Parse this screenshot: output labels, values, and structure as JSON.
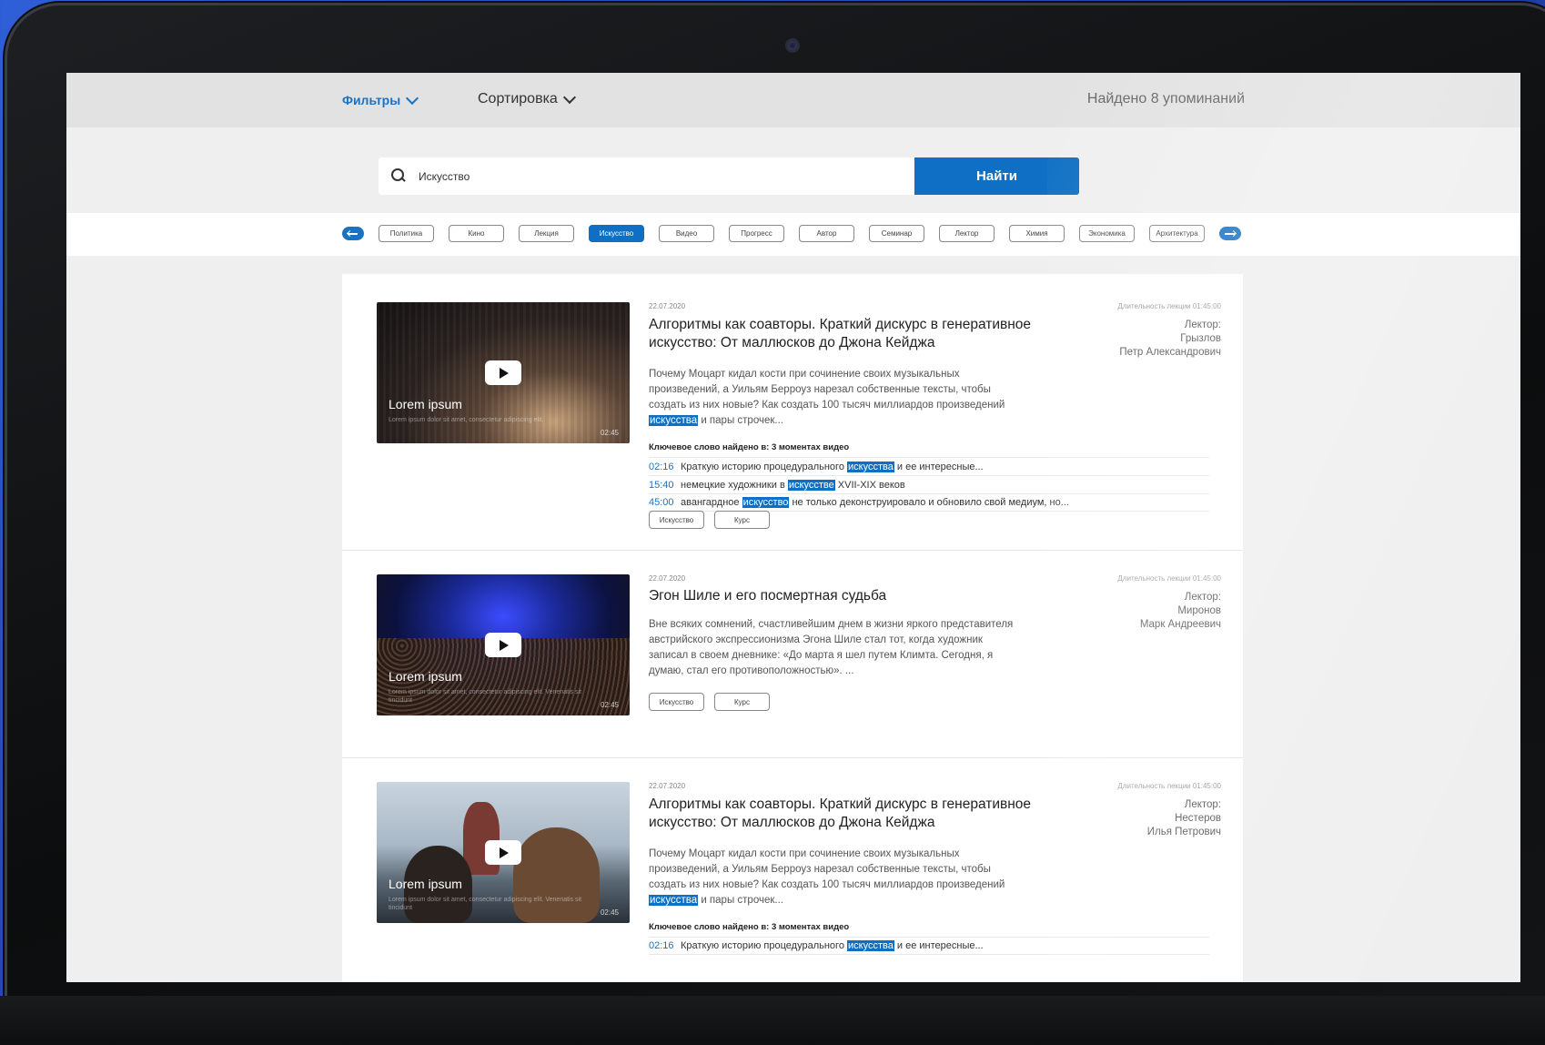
{
  "topbar": {
    "filters_label": "Фильтры",
    "sort_label": "Сортировка",
    "found_text": "Найдено 8 упоминаний"
  },
  "search": {
    "value": "Искусство",
    "button_label": "Найти"
  },
  "tags": [
    "Политика",
    "Кино",
    "Лекция",
    "Искусство",
    "Видео",
    "Прогресс",
    "Автор",
    "Семинар",
    "Лектор",
    "Химия",
    "Экономика",
    "Архитектура"
  ],
  "active_tag": "Искусство",
  "accent_color": "#0e6fc4",
  "results": [
    {
      "thumb_title": "Lorem ipsum",
      "thumb_sub": "Lorem ipsum dolor sit amet, consectetur adipiscing elit.",
      "thumb_duration": "02:45",
      "date": "22.07.2020",
      "title": "Алгоритмы как соавторы. Краткий дискурс в генеративное искусство: От маллюсков до Джона Кейджа",
      "duration_text": "Длительность лекции 01:45:00",
      "lector_label": "Лектор:",
      "lector_last": "Грызлов",
      "lector_first": "Петр Александрович",
      "desc_before": "Почему Моцарт кидал кости при сочинение своих музыкальных произведений, а Уильям Берроуз нарезал собственные тексты, чтобы создать из них новые?  Как создать 100 тысяч миллиардов произведений",
      "desc_hl": "искусства",
      "desc_after": "и пары строчек...",
      "kw_found": "Ключевое слово найдено в:  3 моментах видео",
      "moments": [
        {
          "time": "02:16",
          "before": "Краткую историю процедурального",
          "hl": "искусства",
          "after": "и ее интересные..."
        },
        {
          "time": "15:40",
          "before": "немецкие художники в",
          "hl": "искусстве",
          "after": "XVII-XIX веков"
        },
        {
          "time": "45:00",
          "before": "авангардное",
          "hl": "искусство",
          "after": "не только деконструировало и обновило свой медиум, но..."
        }
      ],
      "tags": [
        "Искусство",
        "Курс"
      ]
    },
    {
      "thumb_title": "Lorem ipsum",
      "thumb_sub": "Lorem ipsum dolor sit amet, consectetur adipiscing elit. Venenatis sit tincidunt",
      "thumb_duration": "02:45",
      "date": "22.07.2020",
      "title": "Эгон Шиле и его посмертная судьба",
      "duration_text": "Длительность лекции 01:45:00",
      "lector_label": "Лектор:",
      "lector_last": "Миронов",
      "lector_first": "Марк Андреевич",
      "desc_before": "Вне всяких сомнений, счастливейшим днем в жизни яркого представителя австрийского экспрессионизма Эгона Шиле стал тот, когда художник записал в своем дневнике: «До марта я шел путем Климта. Сегодня, я думаю, стал его противоположностью». ...",
      "desc_hl": "",
      "desc_after": "",
      "tags": [
        "Искусство",
        "Курс"
      ]
    },
    {
      "thumb_title": "Lorem ipsum",
      "thumb_sub": "Lorem ipsum dolor sit amet, consectetur adipiscing elit. Venenatis sit tincidunt",
      "thumb_duration": "02:45",
      "date": "22.07.2020",
      "title": "Алгоритмы как соавторы. Краткий дискурс в генеративное искусство: От маллюсков до Джона Кейджа",
      "duration_text": "Длительность лекции 01:45:00",
      "lector_label": "Лектор:",
      "lector_last": "Нестеров",
      "lector_first": "Илья Петрович",
      "desc_before": "Почему Моцарт кидал кости при сочинение своих музыкальных произведений, а Уильям Берроуз нарезал собственные тексты, чтобы создать из них новые?  Как создать 100 тысяч миллиардов произведений",
      "desc_hl": "искусства",
      "desc_after": "и пары строчек...",
      "kw_found": "Ключевое слово найдено в:  3 моментах видео",
      "moments": [
        {
          "time": "02:16",
          "before": "Краткую историю процедурального",
          "hl": "искусства",
          "after": "и ее интересные..."
        }
      ]
    }
  ]
}
